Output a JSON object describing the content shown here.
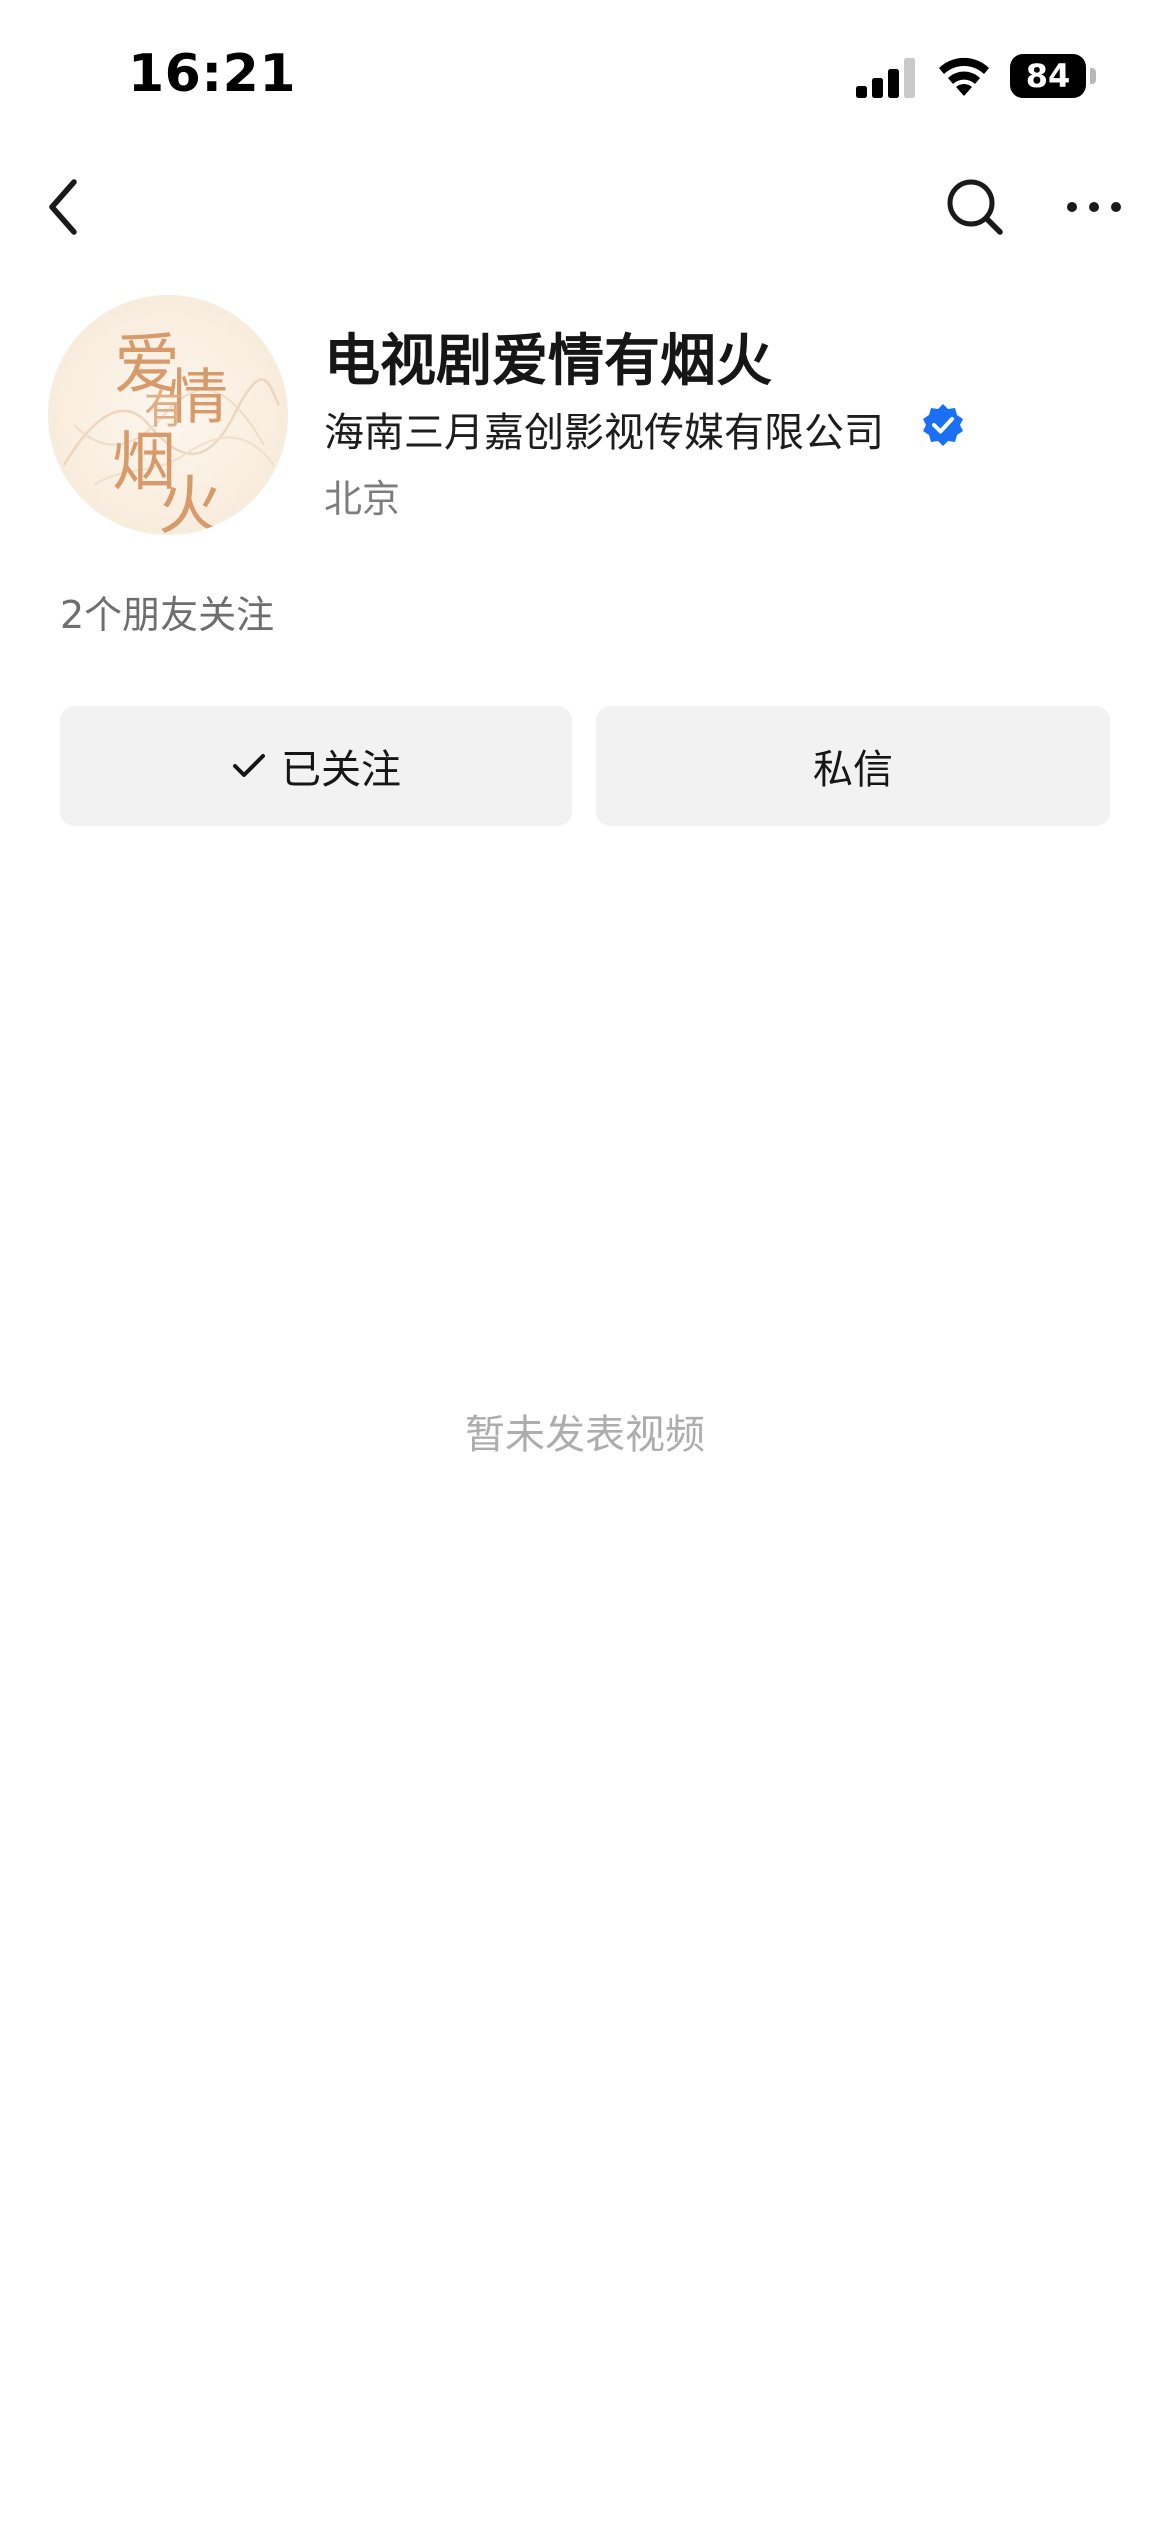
{
  "status_bar": {
    "time": "16:21",
    "battery": "84"
  },
  "nav": {
    "back_icon": "chevron-left-icon",
    "search_icon": "search-icon",
    "more_icon": "more-horizontal-icon"
  },
  "profile": {
    "avatar_text": "爱情有烟火",
    "name": "电视剧爱情有烟火",
    "company": "海南三月嘉创影视传媒有限公司",
    "location": "北京",
    "friends_following": "2个朋友关注"
  },
  "actions": {
    "following_label": "已关注",
    "message_label": "私信"
  },
  "content": {
    "empty_text": "暂未发表视频"
  },
  "colors": {
    "verified": "#1b6ff5",
    "button_bg": "#f2f2f2",
    "muted_text": "#adadad"
  }
}
